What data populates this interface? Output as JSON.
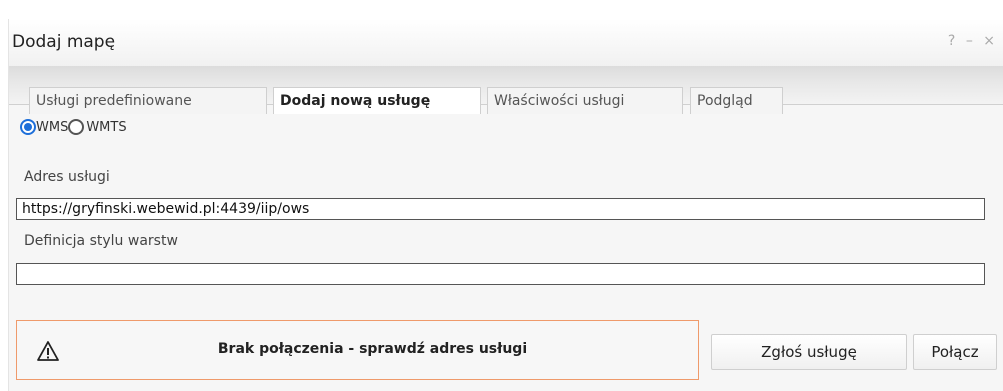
{
  "dialog": {
    "title": "Dodaj mapę",
    "buttons": {
      "help": "?",
      "minimize": "–",
      "close": "×"
    }
  },
  "tabs": [
    {
      "label": "Usługi predefiniowane",
      "active": false
    },
    {
      "label": "Dodaj nową usługę",
      "active": true
    },
    {
      "label": "Właściwości usługi",
      "active": false
    },
    {
      "label": "Podgląd",
      "active": false
    }
  ],
  "service_type": {
    "options": [
      "WMS",
      "WMTS"
    ],
    "selected": "WMS"
  },
  "form": {
    "address_label": "Adres usługi",
    "address_value": "https://gryfinski.webewid.pl:4439/iip/ows",
    "style_label": "Definicja stylu warstw",
    "style_value": ""
  },
  "alert": {
    "icon": "warning-icon",
    "message": "Brak połączenia - sprawdź adres usługi",
    "border_color": "#ef9a6b"
  },
  "actions": {
    "report_label": "Zgłoś usługę",
    "connect_label": "Połącz"
  },
  "colors": {
    "accent": "#1e6fd9"
  }
}
